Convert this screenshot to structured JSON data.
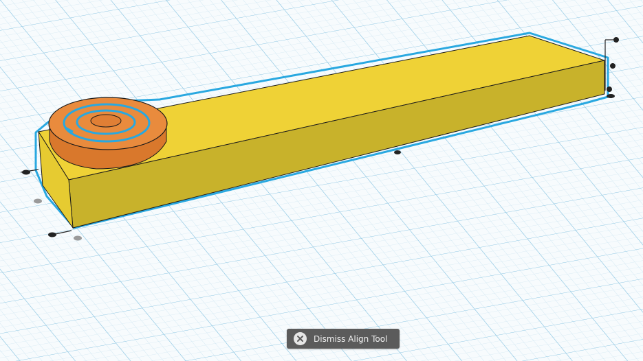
{
  "dismiss_button": {
    "label": "Dismiss Align Tool",
    "icon": "close-icon"
  },
  "colors": {
    "grid_minor": "#cfe6f2",
    "grid_major": "#8cc6e3",
    "selection_outline": "#29a8e0",
    "block_top": "#efd236",
    "block_front": "#c8b22b",
    "block_end": "#e6cb31",
    "ring_top": "#e98b3d",
    "ring_side": "#d9782c",
    "handle": "#222222",
    "handle_shadow": "#9a9a9a",
    "button_bg": "#5b5b5b",
    "button_text": "#f1f1f1"
  }
}
